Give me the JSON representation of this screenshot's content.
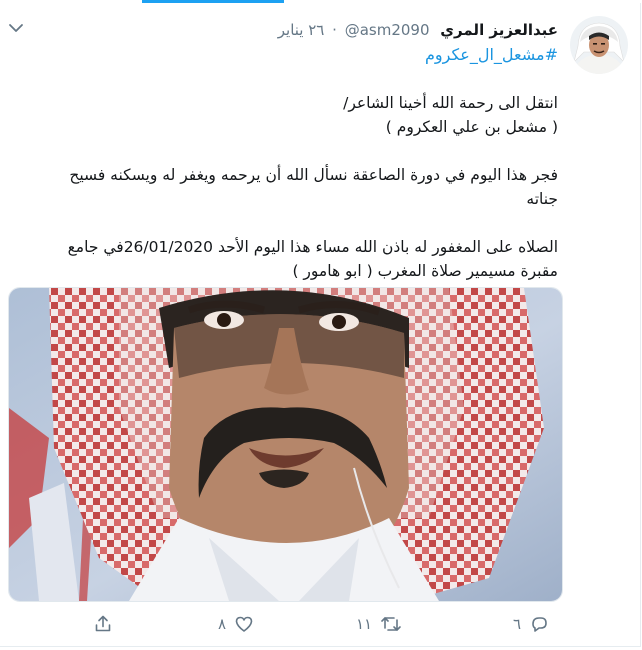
{
  "tweet": {
    "display_name": "عبدالعزيز المري",
    "handle": "@asm2090",
    "separator": "·",
    "time": "٢٦ يناير",
    "hashtag": "#مشعل_ال_عكروم",
    "paragraphs": [
      {
        "line1": "انتقل الى رحمة الله أخينا الشاعر/",
        "line2": "( مشعل بن علي العكروم )"
      },
      {
        "line1": "فجر هذا اليوم في دورة الصاعقة نسأل الله أن يرحمه ويغفر له ويسكنه فسيح",
        "line2": "جناته"
      },
      {
        "line1": "الصلاه على المغفور له باذن الله مساء هذا اليوم الأحد 26/01/2020في جامع",
        "line2": "مقبرة مسيمير صلاة المغرب ( ابو هامور )"
      }
    ]
  },
  "actions": {
    "reply_count": "٦",
    "retweet_count": "١١",
    "like_count": "٨"
  },
  "icons": {
    "menu": "chevron-down-icon",
    "reply": "reply-icon",
    "retweet": "retweet-icon",
    "like": "heart-icon",
    "share": "share-icon"
  },
  "colors": {
    "accent": "#1da1f2",
    "hashtag": "#1b95e0",
    "muted": "#657786",
    "text": "#14171a"
  }
}
